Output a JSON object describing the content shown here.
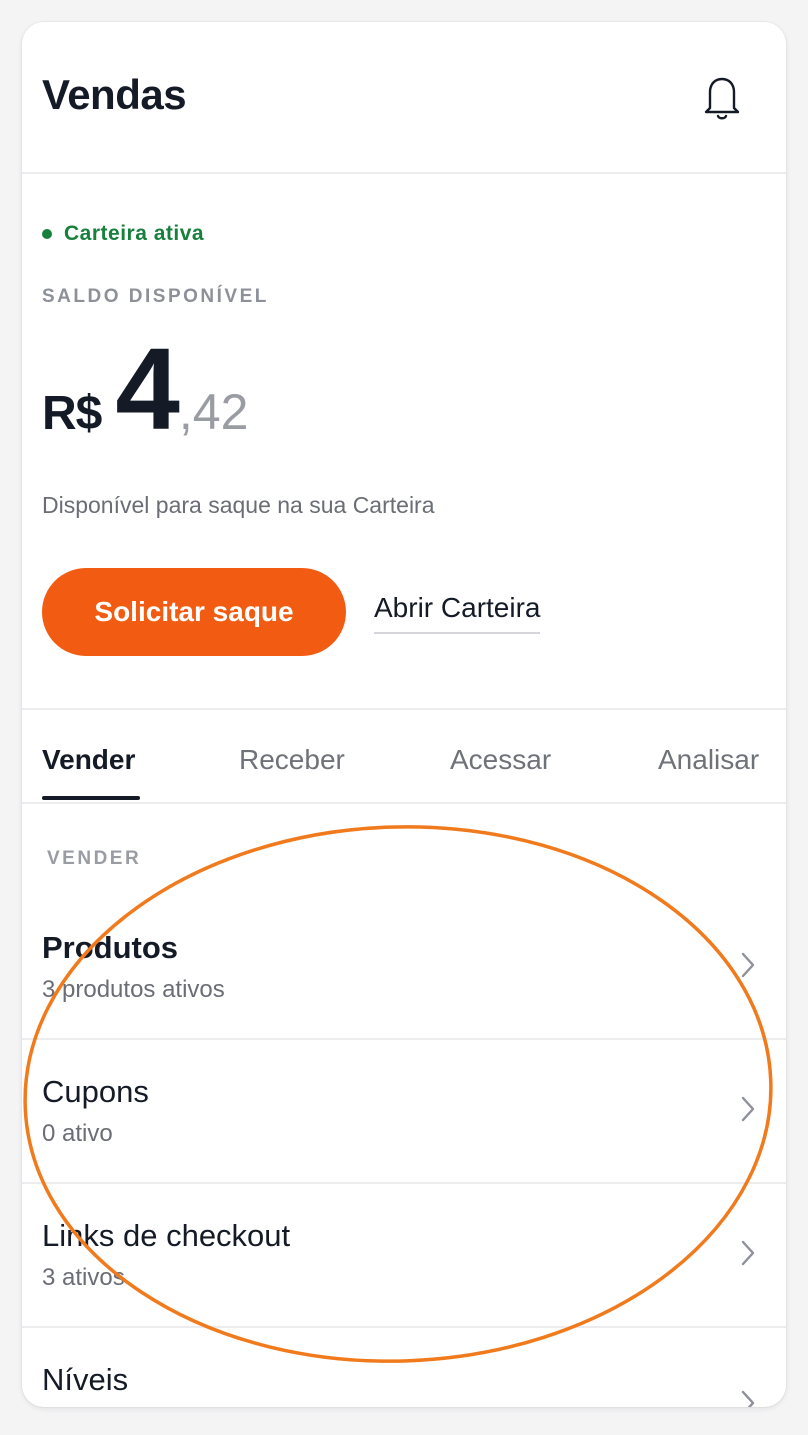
{
  "header": {
    "title": "Vendas",
    "notification_icon": "bell-icon"
  },
  "wallet": {
    "status": "Carteira ativa",
    "status_color": "#17803d",
    "balance_label": "SALDO DISPONÍVEL",
    "currency": "R$",
    "balance_integer": "4",
    "balance_cents": ",42",
    "description": "Disponível para saque na sua Carteira",
    "withdraw_label": "Solicitar saque",
    "open_wallet_label": "Abrir Carteira",
    "accent_color": "#f25c12"
  },
  "tabs": [
    {
      "label": "Vender",
      "active": true
    },
    {
      "label": "Receber",
      "active": false
    },
    {
      "label": "Acessar",
      "active": false
    },
    {
      "label": "Analisar",
      "active": false
    }
  ],
  "section": {
    "label": "VENDER",
    "items": [
      {
        "title": "Produtos",
        "subtitle": "3 produtos ativos"
      },
      {
        "title": "Cupons",
        "subtitle": "0 ativo"
      },
      {
        "title": "Links de checkout",
        "subtitle": "3 ativos"
      },
      {
        "title": "Níveis",
        "subtitle": ""
      }
    ]
  },
  "annotation": {
    "color": "#f07a1c"
  }
}
